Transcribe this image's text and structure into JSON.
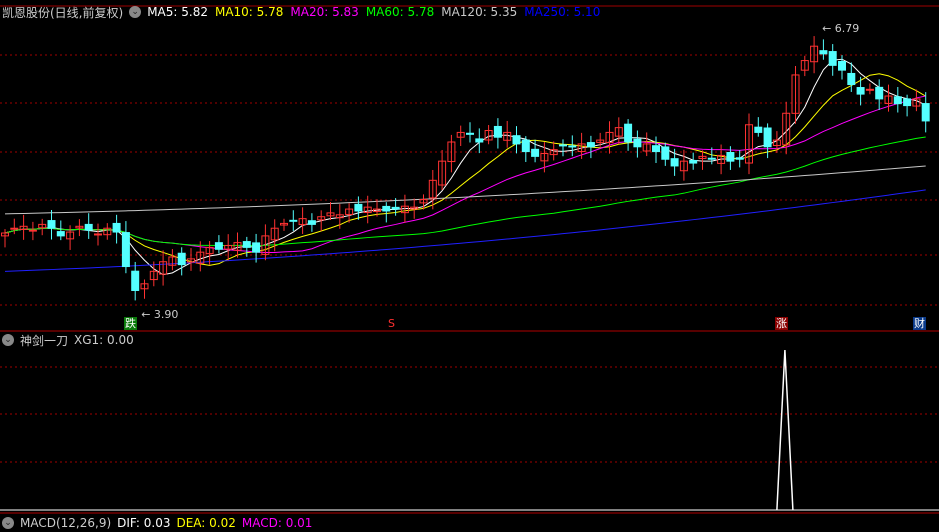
{
  "header": {
    "title": "凯恩股份(日线,前复权)",
    "ma": [
      {
        "label": "MA5: 5.82",
        "color": "#ffffff"
      },
      {
        "label": "MA10: 5.78",
        "color": "#ffff00"
      },
      {
        "label": "MA20: 5.83",
        "color": "#ff00ff"
      },
      {
        "label": "MA60: 5.78",
        "color": "#00ff00"
      },
      {
        "label": "MA120: 5.35",
        "color": "#c8c8c8"
      },
      {
        "label": "MA250: 5.10",
        "color": "#0000ff"
      }
    ]
  },
  "indicator": {
    "title": "神剑一刀",
    "value": "XG1: 0.00"
  },
  "macd": {
    "title": "MACD(12,26,9)",
    "dif": "DIF: 0.03",
    "dea": "DEA: 0.02",
    "macd": "MACD: 0.01"
  },
  "markers": {
    "die": "跌",
    "s": "S",
    "zhang": "涨",
    "cai": "财"
  },
  "chart_data": {
    "type": "candlestick",
    "high_label": "6.79",
    "low_label": "3.90",
    "ylim": [
      3.6,
      7.0
    ],
    "up_color": "#ff3232",
    "down_color": "#54ffff",
    "closes": [
      4.65,
      4.7,
      4.72,
      4.68,
      4.74,
      4.7,
      4.62,
      4.66,
      4.72,
      4.68,
      4.64,
      4.7,
      4.66,
      4.3,
      4.05,
      4.12,
      4.25,
      4.35,
      4.4,
      4.32,
      4.38,
      4.45,
      4.5,
      4.48,
      4.52,
      4.55,
      4.5,
      4.45,
      4.62,
      4.7,
      4.75,
      4.78,
      4.8,
      4.74,
      4.82,
      4.86,
      4.84,
      4.9,
      4.88,
      4.92,
      4.9,
      4.88,
      4.9,
      4.93,
      4.92,
      5.0,
      5.2,
      5.4,
      5.6,
      5.7,
      5.68,
      5.6,
      5.72,
      5.65,
      5.7,
      5.58,
      5.5,
      5.45,
      5.48,
      5.52,
      5.56,
      5.55,
      5.58,
      5.55,
      5.62,
      5.7,
      5.75,
      5.6,
      5.55,
      5.58,
      5.5,
      5.42,
      5.35,
      5.4,
      5.38,
      5.45,
      5.42,
      5.46,
      5.4,
      5.42,
      5.78,
      5.7,
      5.55,
      5.62,
      5.9,
      6.3,
      6.45,
      6.6,
      6.52,
      6.4,
      6.35,
      6.2,
      6.1,
      6.15,
      6.05,
      6.08,
      6.0,
      5.98,
      6.05,
      5.82
    ],
    "ma120_range": [
      4.85,
      5.35
    ],
    "ma250_range": [
      4.25,
      5.1
    ],
    "signal_index": 83
  }
}
